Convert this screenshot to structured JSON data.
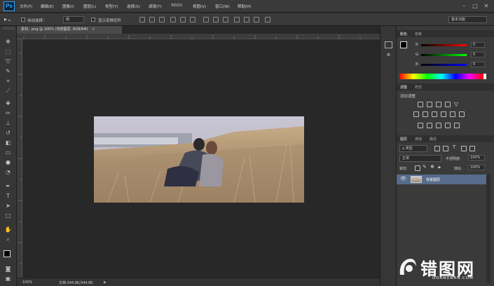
{
  "app": {
    "logo_text": "Ps"
  },
  "menu": {
    "items": [
      "文件(F)",
      "编辑(E)",
      "图像(I)",
      "图层(L)",
      "类型(Y)",
      "选择(S)",
      "滤镜(T)",
      "3D(D)",
      "视图(V)",
      "窗口(W)",
      "帮助(H)"
    ]
  },
  "window_controls": {
    "minimize": "–",
    "maximize": "□",
    "close": "✕"
  },
  "options": {
    "auto_select_label": "自动选择：",
    "auto_select_value": "组",
    "show_transform_label": "显示变换控件",
    "workspace_value": "基本功能"
  },
  "document": {
    "tab_title": "素材。png @ 100% (背景图层, RGB/8#)",
    "zoom": "100%",
    "doc_info": "文档:344.8K/344.8K"
  },
  "tools": [
    "move-tool",
    "marquee-tool",
    "lasso-tool",
    "quick-select-tool",
    "crop-tool",
    "eyedropper-tool",
    "healing-brush-tool",
    "brush-tool",
    "clone-stamp-tool",
    "history-brush-tool",
    "eraser-tool",
    "gradient-tool",
    "blur-tool",
    "dodge-tool",
    "pen-tool",
    "type-tool",
    "path-select-tool",
    "shape-tool",
    "hand-tool",
    "zoom-tool"
  ],
  "color_panel": {
    "tabs": [
      "颜色",
      "色板"
    ],
    "channels": [
      {
        "label": "R",
        "value": "0"
      },
      {
        "label": "G",
        "value": "0"
      },
      {
        "label": "B",
        "value": "0"
      }
    ]
  },
  "adjustments_panel": {
    "tabs": [
      "调整",
      "样式"
    ],
    "title": "添加调整"
  },
  "layers_panel": {
    "tabs": [
      "图层",
      "通道",
      "路径"
    ],
    "kind_filter": "ρ 类型",
    "blend_mode": "正常",
    "opacity_label": "不透明度:",
    "opacity_value": "100%",
    "lock_label": "锁定:",
    "fill_label": "填充:",
    "fill_value": "100%",
    "layer_name": "背景图层"
  },
  "watermark": {
    "brand": "错图网",
    "url": "DOANDBAN.COM"
  },
  "colors": {
    "accent": "#31a8ff",
    "selected_layer": "#566c8a",
    "workspace_bg": "#282828"
  }
}
